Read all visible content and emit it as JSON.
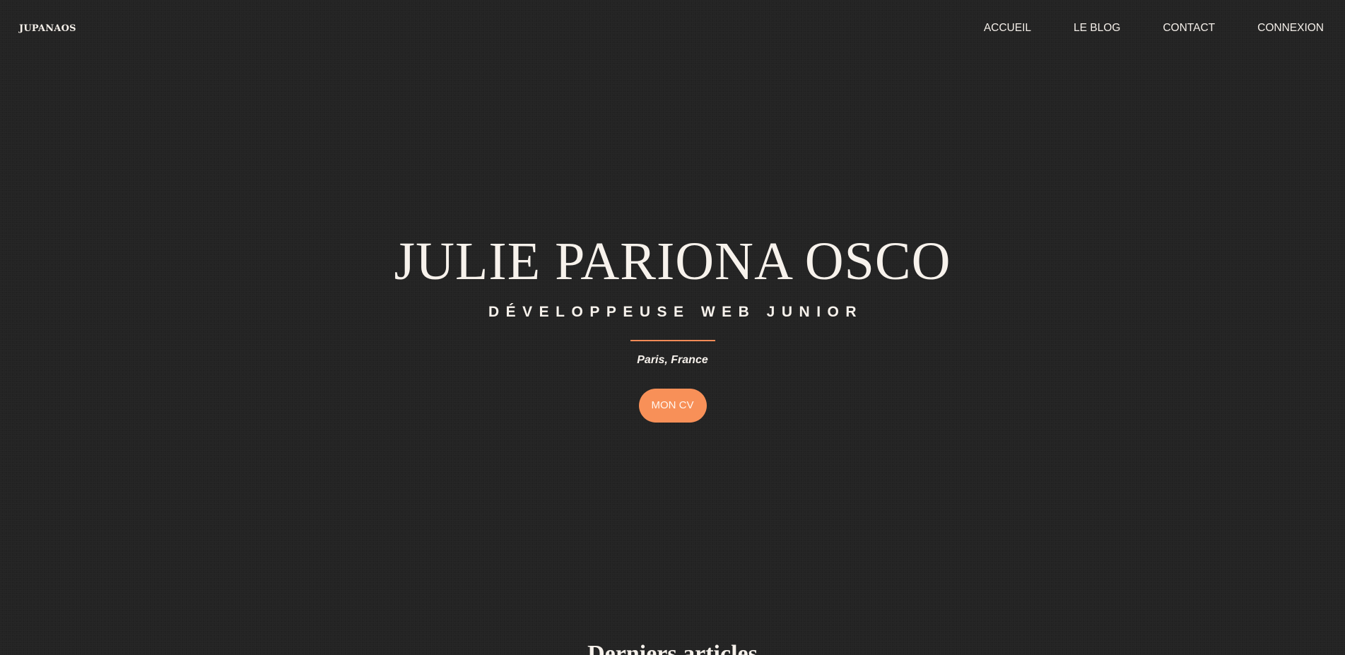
{
  "header": {
    "brand": "JUPANAOS",
    "nav": [
      {
        "label": "ACCUEIL"
      },
      {
        "label": "LE BLOG"
      },
      {
        "label": "CONTACT"
      },
      {
        "label": "CONNEXION"
      }
    ]
  },
  "hero": {
    "name": "JULIE PARIONA OSCO",
    "role": "DÉVELOPPEUSE WEB JUNIOR",
    "location": "Paris, France",
    "cv_button": "MON CV"
  },
  "articles": {
    "title": "Derniers articles"
  },
  "colors": {
    "background": "#232323",
    "accent": "#f89058",
    "text": "#f7f2ec"
  }
}
